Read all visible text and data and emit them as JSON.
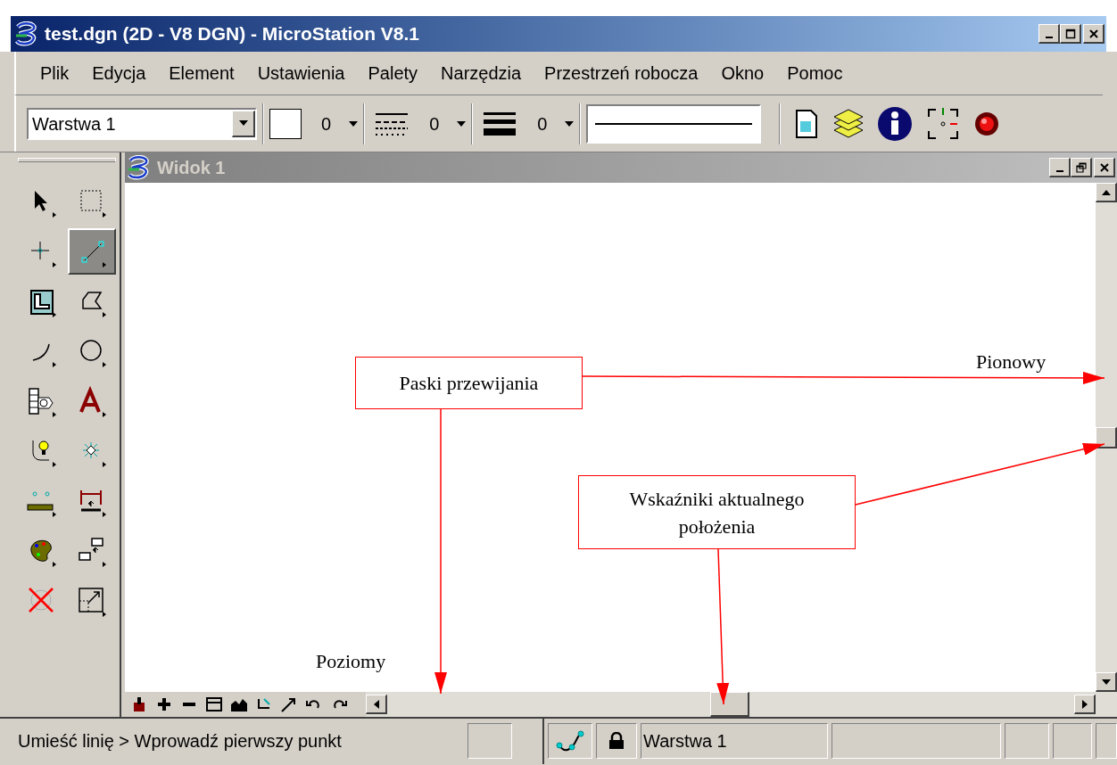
{
  "window": {
    "title": "test.dgn (2D - V8 DGN) - MicroStation V8.1"
  },
  "menu": [
    "Plik",
    "Edycja",
    "Element",
    "Ustawienia",
    "Palety",
    "Narzędzia",
    "Przestrzeń robocza",
    "Okno",
    "Pomoc"
  ],
  "toolbar": {
    "level": "Warstwa 1",
    "color_index": "0",
    "style": "0",
    "weight": "0"
  },
  "tool_palette": [
    {
      "selected": false
    },
    {
      "selected": false
    },
    {
      "selected": false
    },
    {
      "selected": true
    },
    {
      "selected": false
    },
    {
      "selected": false
    },
    {
      "selected": false
    },
    {
      "selected": false
    },
    {
      "selected": false
    },
    {
      "selected": false
    },
    {
      "selected": false
    },
    {
      "selected": false
    },
    {
      "selected": false
    },
    {
      "selected": false
    },
    {
      "selected": false
    },
    {
      "selected": false
    },
    {
      "selected": false
    },
    {
      "selected": false
    }
  ],
  "view": {
    "title": "Widok 1"
  },
  "annotations": [
    {
      "kind": "box",
      "text": "Paski przewijania"
    },
    {
      "kind": "label",
      "text": "Pionowy"
    },
    {
      "kind": "box",
      "text": "Wskaźniki aktualnego położenia"
    },
    {
      "kind": "label",
      "text": "Poziomy"
    }
  ],
  "status_bar": {
    "prompt": "Umieść linię > Wprowadź pierwszy punkt",
    "level": "Warstwa 1"
  }
}
